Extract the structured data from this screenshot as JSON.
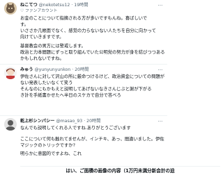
{
  "tweets": [
    {
      "name": "ねこてつ",
      "handle": "@nekotetsu12",
      "time": "19時間",
      "badge": "ファンアカウント",
      "lines": [
        "お金のことについて指摘される方が多いですもんね。喜ばしいで",
        "す。",
        "いささか几帳面でなく、感覚の力らないない人たちを自分に向かって",
        "向けていきますです。",
        "",
        "基督教会の男方には警戒します。",
        "政治と力本間題にずっと取り組んでいた公明党の努力が身を結びつつあるの",
        "かもしれないですね。"
      ]
    },
    {
      "name": "みゅう",
      "handle": "@yunyunyunkon",
      "time": "20時間",
      "lines": [
        "伊佐さんに対して沢山の所に厳命つけるけど、政治資金についての問題が",
        "ない発表したいなくて笑う",
        "そんなのにもかもえと説明してあげないなきさんじぶと謝が下がる",
        "き計を手紙書かせたへ半日のスケカで自分で答べろ"
      ]
    },
    {
      "name": "乾上杉シンパシー",
      "handle": "@masao_93",
      "time": "20時間",
      "lines": [
        "なんでも説明してくれる人ですね.ありがとうございます",
        "",
        "ここについて何も触れてませんが、インチキ、あっ、間違いました。伊佐",
        "マジックのトリックですか?",
        "",
        "明らかに意図的ですよね、これ"
      ]
    }
  ],
  "banner": "はい、ご面積の画像の内容（1万円未満分新会計の迫"
}
